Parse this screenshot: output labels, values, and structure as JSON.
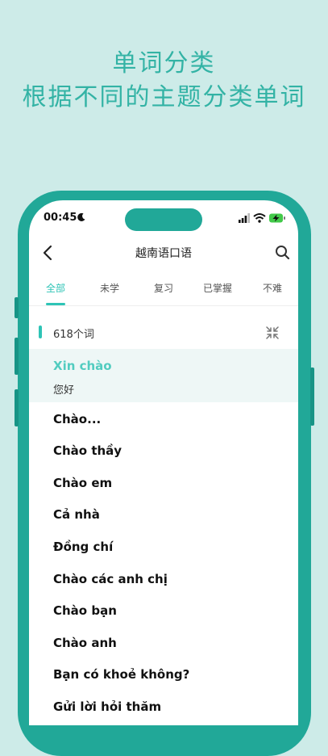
{
  "promo": {
    "title": "单词分类",
    "subtitle": "根据不同的主题分类单词"
  },
  "status_bar": {
    "time": "00:45"
  },
  "nav": {
    "title": "越南语口语"
  },
  "tabs": [
    "全部",
    "未学",
    "复习",
    "已掌握",
    "不难"
  ],
  "list": {
    "count_label": "618个词",
    "highlight": {
      "word": "Xin chào",
      "meaning": "您好"
    },
    "words": [
      "Chào...",
      "Chào thầy",
      "Chào em",
      "Cả nhà",
      "Đồng chí",
      "Chào các anh chị",
      "Chào bạn",
      "Chào anh",
      "Bạn có khoẻ không?",
      "Gửi lời hỏi thăm"
    ]
  },
  "colors": {
    "background": "#cdebe8",
    "headline": "#33b3a5",
    "phone_frame": "#21a898",
    "accent": "#2ec4b6",
    "highlight_bg": "#eef7f6"
  }
}
